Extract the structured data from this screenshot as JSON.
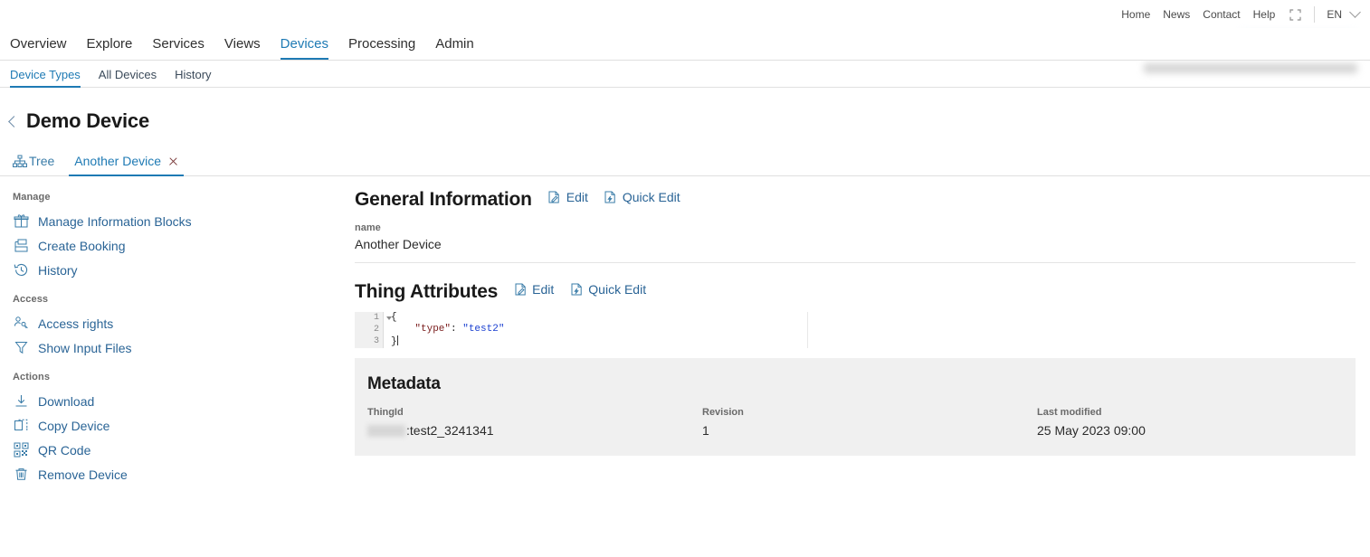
{
  "topbar": {
    "links": [
      {
        "label": "Home"
      },
      {
        "label": "News"
      },
      {
        "label": "Contact"
      },
      {
        "label": "Help"
      }
    ],
    "fullscreen_icon": "fullscreen-icon",
    "language": "EN",
    "chevron_icon": "chevron-down-icon"
  },
  "mainnav": {
    "items": [
      {
        "label": "Overview",
        "active": false
      },
      {
        "label": "Explore",
        "active": false
      },
      {
        "label": "Services",
        "active": false
      },
      {
        "label": "Views",
        "active": false
      },
      {
        "label": "Devices",
        "active": true
      },
      {
        "label": "Processing",
        "active": false
      },
      {
        "label": "Admin",
        "active": false
      }
    ]
  },
  "subnav": {
    "items": [
      {
        "label": "Device Types",
        "active": true
      },
      {
        "label": "All Devices",
        "active": false
      },
      {
        "label": "History",
        "active": false
      }
    ]
  },
  "page": {
    "back_icon": "chevron-left-icon",
    "title": "Demo Device"
  },
  "device_tabs": [
    {
      "label": "Tree",
      "icon": "tree-hierarchy-icon",
      "active": false,
      "closable": false
    },
    {
      "label": "Another Device",
      "icon": "",
      "active": true,
      "closable": true
    }
  ],
  "sidebar": {
    "groups": [
      {
        "title": "Manage",
        "items": [
          {
            "label": "Manage Information Blocks",
            "icon": "information-blocks-icon"
          },
          {
            "label": "Create Booking",
            "icon": "booking-icon"
          },
          {
            "label": "History",
            "icon": "history-clock-icon"
          }
        ]
      },
      {
        "title": "Access",
        "items": [
          {
            "label": "Access rights",
            "icon": "user-key-icon"
          },
          {
            "label": "Show Input Files",
            "icon": "filter-funnel-icon"
          }
        ]
      },
      {
        "title": "Actions",
        "items": [
          {
            "label": "Download",
            "icon": "download-icon"
          },
          {
            "label": "Copy Device",
            "icon": "copy-icon"
          },
          {
            "label": "QR Code",
            "icon": "qr-code-icon"
          },
          {
            "label": "Remove Device",
            "icon": "trash-icon"
          }
        ]
      }
    ]
  },
  "general_information": {
    "title": "General Information",
    "edit_label": "Edit",
    "quick_edit_label": "Quick Edit",
    "edit_icon": "edit-document-icon",
    "quick_edit_icon": "quick-edit-document-icon",
    "field_label": "name",
    "field_value": "Another Device"
  },
  "thing_attributes": {
    "title": "Thing Attributes",
    "edit_label": "Edit",
    "quick_edit_label": "Quick Edit",
    "edit_icon": "edit-document-icon",
    "quick_edit_icon": "quick-edit-document-icon",
    "code": {
      "line_numbers": [
        "1",
        "2",
        "3"
      ],
      "line1": "{",
      "line2_indent": "    ",
      "line2_key": "\"type\"",
      "line2_colon": ": ",
      "line2_value": "\"test2\"",
      "line3": "}"
    }
  },
  "metadata": {
    "title": "Metadata",
    "thing_id_label": "ThingId",
    "thing_id_value": ":test2_3241341",
    "revision_label": "Revision",
    "revision_value": "1",
    "last_modified_label": "Last modified",
    "last_modified_value": "25 May 2023 09:00"
  },
  "colors": {
    "accent": "#1e7ab4",
    "link": "#2a6496",
    "panel_bg": "#f0f0f0",
    "text": "#2b2b2b",
    "muted": "#6a6a6a"
  }
}
